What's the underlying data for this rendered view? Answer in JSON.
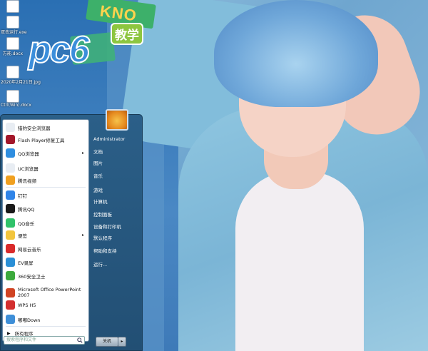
{
  "desktop": {
    "icons": [
      {
        "label": "",
        "top": 0
      },
      {
        "label": "双击运行.exe"
      },
      {
        "label": "万能.docx"
      },
      {
        "label": "2020年2月21日.jpg"
      },
      {
        "label": "Ctrl(Win).docx"
      }
    ],
    "logo_text": "pc6",
    "logo_badge": "教学",
    "sign_text": "KNO"
  },
  "start_menu": {
    "programs": [
      {
        "label": "猎豹安全浏览器",
        "icon": "browser-icon",
        "color": "#e8edf3"
      },
      {
        "label": "Flash Player修复工具",
        "icon": "flash-icon",
        "color": "#a3172a"
      },
      {
        "label": "QQ浏览器",
        "icon": "qq-browser-icon",
        "color": "#2f8ee0",
        "submenu": "▸"
      },
      {
        "label": "UC浏览器",
        "icon": "uc-browser-icon",
        "color": "#e8edf3"
      },
      {
        "label": "腾讯视频",
        "icon": "tencent-video-icon",
        "color": "#f0a020"
      },
      {
        "label": "钉钉",
        "icon": "dingtalk-icon",
        "color": "#2f84e8"
      },
      {
        "label": "腾讯QQ",
        "icon": "qq-penguin-icon",
        "color": "#1a1a1a"
      },
      {
        "label": "QQ音乐",
        "icon": "qq-music-icon",
        "color": "#30c26a"
      },
      {
        "label": "便签",
        "icon": "notes-icon",
        "color": "#f2c53d",
        "submenu": "▸"
      },
      {
        "label": "网易云音乐",
        "icon": "netease-music-icon",
        "color": "#d92b2b"
      },
      {
        "label": "EV录屏",
        "icon": "ev-recorder-icon",
        "color": "#2a8fd6"
      },
      {
        "label": "360安全卫士",
        "icon": "360-shield-icon",
        "color": "#3caa3c"
      },
      {
        "label": "Microsoft Office PowerPoint 2007",
        "icon": "powerpoint-icon",
        "color": "#d04423"
      },
      {
        "label": "WPS H5",
        "icon": "wps-icon",
        "color": "#d32f2f"
      },
      {
        "label": "嘟嘟Down",
        "icon": "download-icon",
        "color": "#3e8fd8"
      }
    ],
    "all_programs": "所有程序",
    "search_placeholder": "搜索程序和文件",
    "right_items": [
      "Administrator",
      "文档",
      "图片",
      "音乐",
      "游戏",
      "计算机",
      "控制面板",
      "设备和打印机",
      "默认程序",
      "帮助和支持",
      "运行..."
    ],
    "shutdown_label": "关机",
    "shutdown_arrow": "▸"
  }
}
